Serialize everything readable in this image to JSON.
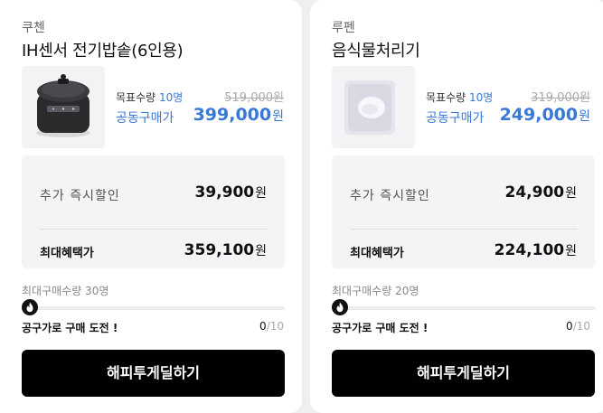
{
  "products": [
    {
      "brand": "쿠첸",
      "name": "IH센서 전기밥솥(6인용)",
      "image_icon": "rice-cooker-icon",
      "goal_label": "목표수량",
      "goal_count": "10명",
      "original_price": "519,000",
      "groupbuy_label": "공동구매가",
      "groupbuy_price": "399,000",
      "extra_discount_label": "추가 즉시할인",
      "extra_discount_value": "39,900",
      "max_benefit_label": "최대혜택가",
      "max_benefit_value": "359,100",
      "currency": "원",
      "max_purchase_text": "최대구매수량 30명",
      "challenge_text": "공구가로 구매 도전 !",
      "current_count": "0",
      "total_count": "/10",
      "progress_fraction": 0,
      "cta_label": "해피투게딜하기"
    },
    {
      "brand": "루펜",
      "name": "음식물처리기",
      "image_icon": "food-waste-disposer-icon",
      "goal_label": "목표수량",
      "goal_count": "10명",
      "original_price": "319,000",
      "groupbuy_label": "공동구매가",
      "groupbuy_price": "249,000",
      "extra_discount_label": "추가 즉시할인",
      "extra_discount_value": "24,900",
      "max_benefit_label": "최대혜택가",
      "max_benefit_value": "224,100",
      "currency": "원",
      "max_purchase_text": "최대구매수량 20명",
      "challenge_text": "공구가로 구매 도전 !",
      "current_count": "0",
      "total_count": "/10",
      "progress_fraction": 0,
      "cta_label": "해피투게딜하기"
    }
  ],
  "colors": {
    "accent": "#3a78d8",
    "cta_bg": "#000000",
    "page_bg": "#efeff1"
  }
}
